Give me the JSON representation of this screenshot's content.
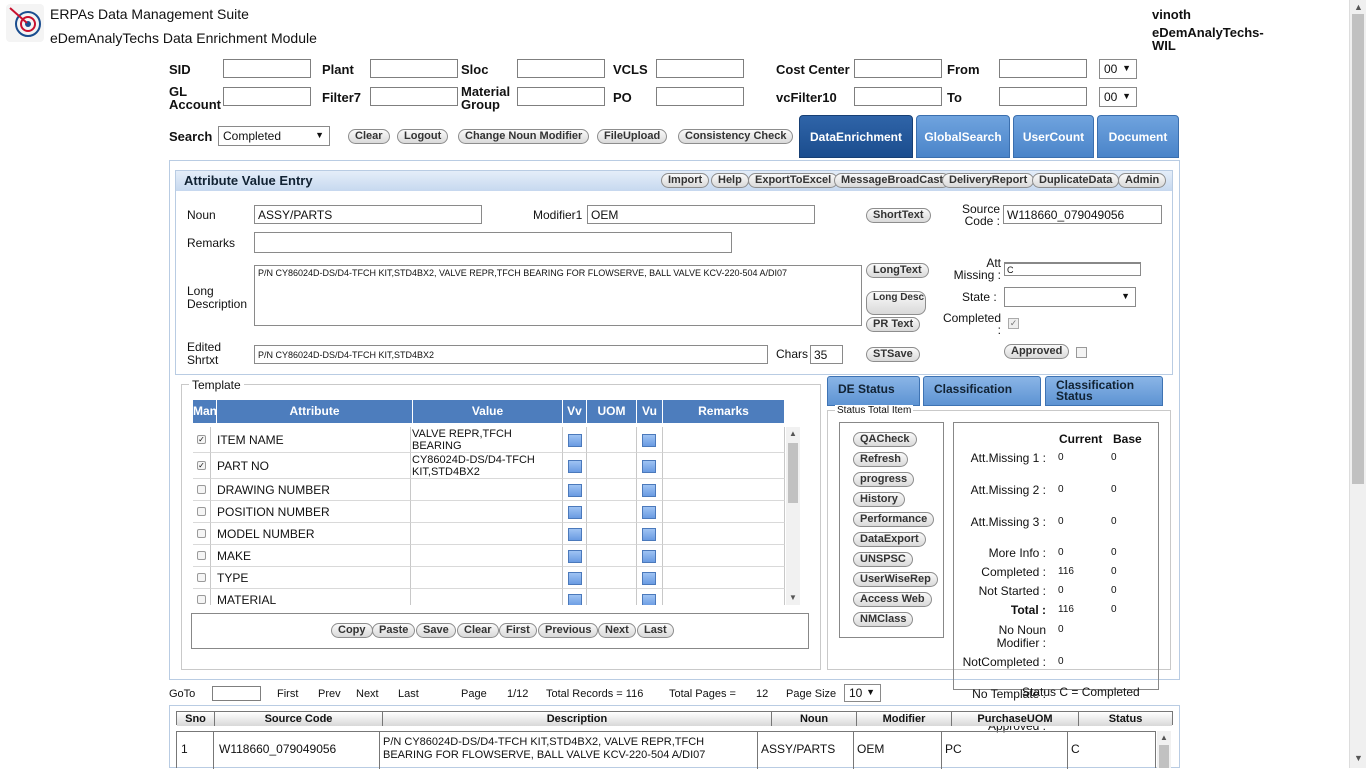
{
  "header": {
    "app_title": "ERPAs Data Management Suite",
    "module_title": "eDemAnalyTechs Data Enrichment Module",
    "user": "vinoth",
    "org": "eDemAnalyTechs-WIL"
  },
  "filters": {
    "sid": "SID",
    "plant": "Plant",
    "sloc": "Sloc",
    "vcls": "VCLS",
    "cost_center": "Cost Center",
    "from": "From",
    "gl_account": "GL Account",
    "filter7": "Filter7",
    "material_group": "Material Group",
    "po": "PO",
    "vcfilter10": "vcFilter10",
    "to": "To",
    "from_time": "00",
    "to_time": "00"
  },
  "toolbar": {
    "search_label": "Search",
    "search_value": "Completed",
    "clear": "Clear",
    "logout": "Logout",
    "change_noun_modifier": "Change Noun Modifier",
    "file_upload": "FileUpload",
    "consistency_check": "Consistency Check"
  },
  "tabs": [
    "DataEnrichment",
    "GlobalSearch",
    "UserCount",
    "Document"
  ],
  "attribute_entry": {
    "title": "Attribute Value Entry",
    "actions": [
      "Import",
      "Help",
      "ExportToExcel",
      "MessageBroadCast",
      "DeliveryReport",
      "DuplicateData",
      "Admin"
    ],
    "noun_label": "Noun",
    "noun_value": "ASSY/PARTS",
    "modifier_label": "Modifier1",
    "modifier_value": "OEM",
    "short_text_btn": "ShortText",
    "source_code_label": "Source Code :",
    "source_code_value": "W118660_079049056",
    "remarks_label": "Remarks",
    "long_desc_label": "Long Description",
    "long_desc_value": "P/N CY86024D-DS/D4-TFCH KIT,STD4BX2, VALVE REPR,TFCH BEARING FOR FLOWSERVE, BALL VALVE KCV-220-504 A/DI07",
    "long_text_btn": "LongText",
    "long_desc_btn": "Long Desc",
    "pr_text_btn": "PR Text",
    "att_missing_label": "Att Missing :",
    "att_missing_value": "C",
    "state_label": "State :",
    "completed_label": "Completed :",
    "edited_shrtxt_label": "Edited Shrtxt",
    "edited_shrtxt_value": "P/N CY86024D-DS/D4-TFCH KIT,STD4BX2",
    "chars_label": "Chars",
    "chars_value": "35",
    "stsave_btn": "STSave",
    "approved_btn": "Approved"
  },
  "template": {
    "legend": "Template",
    "columns": [
      "Man",
      "Attribute",
      "Value",
      "Vv",
      "UOM",
      "Vu",
      "Remarks"
    ],
    "rows": [
      {
        "checked": true,
        "attribute": "ITEM NAME",
        "value": "VALVE REPR,TFCH BEARING"
      },
      {
        "checked": true,
        "attribute": "PART NO",
        "value": "CY86024D-DS/D4-TFCH KIT,STD4BX2"
      },
      {
        "checked": false,
        "attribute": "DRAWING NUMBER",
        "value": ""
      },
      {
        "checked": false,
        "attribute": "POSITION NUMBER",
        "value": ""
      },
      {
        "checked": false,
        "attribute": "MODEL NUMBER",
        "value": ""
      },
      {
        "checked": false,
        "attribute": "MAKE",
        "value": ""
      },
      {
        "checked": false,
        "attribute": "TYPE",
        "value": ""
      },
      {
        "checked": false,
        "attribute": "MATERIAL",
        "value": ""
      }
    ],
    "buttons": [
      "Copy",
      "Paste",
      "Save",
      "Clear",
      "First",
      "Previous",
      "Next",
      "Last"
    ]
  },
  "right_tabs": [
    "DE Status",
    "Classification",
    "Classification Status"
  ],
  "status": {
    "legend": "Status Total Item",
    "buttons": [
      "QACheck",
      "Refresh",
      "progress",
      "History",
      "Performance",
      "DataExport",
      "UNSPSC",
      "UserWiseRep",
      "Access Web",
      "NMClass"
    ],
    "current_header": "Current",
    "base_header": "Base",
    "rows": [
      {
        "label": "Att.Missing 1 :",
        "current": "0",
        "base": "0"
      },
      {
        "label": "Att.Missing 2 :",
        "current": "0",
        "base": "0"
      },
      {
        "label": "Att.Missing 3 :",
        "current": "0",
        "base": "0"
      },
      {
        "label": "More Info :",
        "current": "0",
        "base": "0"
      },
      {
        "label": "Completed :",
        "current": "116",
        "base": "0"
      },
      {
        "label": "Not Started :",
        "current": "0",
        "base": "0"
      },
      {
        "label": "Total :",
        "current": "116",
        "base": "0"
      },
      {
        "label": "No Noun Modifier :",
        "current": "0",
        "base": ""
      },
      {
        "label": "NotCompleted :",
        "current": "0",
        "base": ""
      },
      {
        "label": "No Template :",
        "current": "",
        "base": ""
      },
      {
        "label": "Approved :",
        "current": "",
        "base": ""
      }
    ],
    "status_note": "Status C = Completed"
  },
  "pager": {
    "goto": "GoTo",
    "first": "First",
    "prev": "Prev",
    "next": "Next",
    "last": "Last",
    "page_label": "Page",
    "page_value": "1/12",
    "total_records": "Total Records = 116",
    "total_pages_label": "Total Pages =",
    "total_pages_value": "12",
    "page_size_label": "Page Size",
    "page_size_value": "10"
  },
  "data_grid": {
    "columns": [
      "Sno",
      "Source Code",
      "Description",
      "Noun",
      "Modifier",
      "PurchaseUOM",
      "Status"
    ],
    "rows": [
      {
        "sno": "1",
        "source_code": "W118660_079049056",
        "description": "P/N CY86024D-DS/D4-TFCH KIT,STD4BX2, VALVE REPR,TFCH BEARING FOR FLOWSERVE, BALL VALVE KCV-220-504 A/DI07",
        "noun": "ASSY/PARTS",
        "modifier": "OEM",
        "uom": "PC",
        "status": "C"
      }
    ]
  }
}
